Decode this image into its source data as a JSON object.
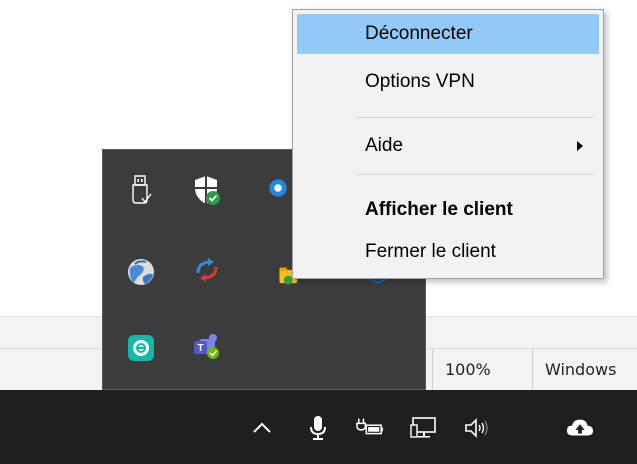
{
  "context_menu": {
    "items": [
      {
        "label": "Déconnecter",
        "highlighted": true
      },
      {
        "label": "Options VPN"
      },
      {
        "label": "Aide",
        "has_submenu": true
      },
      {
        "label": "Afficher le client",
        "bold": true
      },
      {
        "label": "Fermer le client"
      }
    ]
  },
  "tray_flyout": {
    "icons": [
      {
        "name": "usb-drive-icon"
      },
      {
        "name": "windows-security-shield-icon"
      },
      {
        "name": "blue-app-icon"
      },
      {
        "name": "globe-vpn-icon"
      },
      {
        "name": "sync-arrows-icon"
      },
      {
        "name": "folder-sync-icon"
      },
      {
        "name": "eset-icon"
      },
      {
        "name": "teams-icon"
      }
    ]
  },
  "status_bar": {
    "zoom": "100%",
    "line_ending": "Windows"
  },
  "taskbar": {
    "icons": [
      {
        "name": "chevron-up-icon"
      },
      {
        "name": "microphone-icon"
      },
      {
        "name": "battery-plug-icon"
      },
      {
        "name": "network-icon"
      },
      {
        "name": "volume-icon"
      },
      {
        "name": "cloud-upload-icon"
      }
    ]
  },
  "colors": {
    "menu_highlight": "#91c9f7",
    "menu_background": "#f2f2f2",
    "flyout_background": "#3c3c3c",
    "taskbar_background": "#1f1f1f"
  }
}
